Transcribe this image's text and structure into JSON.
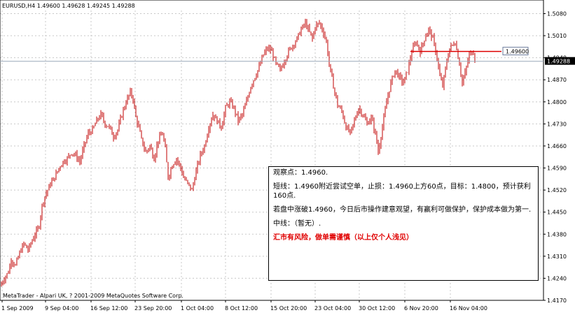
{
  "chart_header": "EURUSD,H4  1.49600 1.49628 1.49245 1.49288",
  "footer_text": "MetaTrader - Alpari UK, ? 2001-2009 MetaQuotes Software Corp.",
  "note": {
    "line1": "观察点：1.4960.",
    "line2": "短线：1.4960附近尝试空单，止损：1.4960上方60点，目标：1.4800，预计获利160点.",
    "line3": "若盘中涨破1.4960，今日后市操作建意观望，有赢利可做保护，保护成本做为第一.",
    "line4": "中线：（暂无）.",
    "warning": "汇市有风险，做单需谨慎（以上仅个人浅见）"
  },
  "colors": {
    "candle": "#c00000",
    "bid_line": "#9aa8b8",
    "hline": "#dd0000",
    "grid": "#c8c8c8"
  },
  "chart_data": {
    "type": "ohlc",
    "symbol": "EURUSD",
    "timeframe": "H4",
    "header": {
      "open": 1.496,
      "high": 1.49628,
      "low": 1.49245,
      "close": 1.49288
    },
    "ylim": [
      1.417,
      1.509
    ],
    "y_ticks": [
      1.508,
      1.501,
      1.494,
      1.487,
      1.48,
      1.473,
      1.466,
      1.459,
      1.452,
      1.445,
      1.438,
      1.431,
      1.424,
      1.417
    ],
    "x_ticks": [
      "1 Sep 2009",
      "9 Sep 04:00",
      "16 Sep 12:00",
      "23 Sep 20:00",
      "1 Oct 04:00",
      "8 Oct 12:00",
      "15 Oct 20:00",
      "23 Oct 04:00",
      "30 Oct 12:00",
      "6 Nov 20:00",
      "16 Nov 04:00"
    ],
    "current_price": "1.49288",
    "horizontal_line": {
      "price": 1.496,
      "label": "1.49600"
    },
    "path": [
      [
        0,
        1.4215
      ],
      [
        6,
        1.424
      ],
      [
        12,
        1.426
      ],
      [
        16,
        1.43
      ],
      [
        22,
        1.428
      ],
      [
        28,
        1.432
      ],
      [
        34,
        1.435
      ],
      [
        40,
        1.433
      ],
      [
        46,
        1.436
      ],
      [
        50,
        1.438
      ],
      [
        53,
        1.439
      ],
      [
        56,
        1.441
      ],
      [
        60,
        1.447
      ],
      [
        64,
        1.45
      ],
      [
        68,
        1.452
      ],
      [
        72,
        1.454
      ],
      [
        78,
        1.456
      ],
      [
        84,
        1.459
      ],
      [
        90,
        1.461
      ],
      [
        96,
        1.462
      ],
      [
        102,
        1.464
      ],
      [
        108,
        1.463
      ],
      [
        114,
        1.461
      ],
      [
        120,
        1.466
      ],
      [
        126,
        1.47
      ],
      [
        132,
        1.471
      ],
      [
        138,
        1.474
      ],
      [
        144,
        1.476
      ],
      [
        150,
        1.473
      ],
      [
        156,
        1.472
      ],
      [
        162,
        1.469
      ],
      [
        168,
        1.471
      ],
      [
        174,
        1.476
      ],
      [
        180,
        1.48
      ],
      [
        186,
        1.483
      ],
      [
        190,
        1.481
      ],
      [
        194,
        1.475
      ],
      [
        198,
        1.472
      ],
      [
        202,
        1.468
      ],
      [
        208,
        1.464
      ],
      [
        214,
        1.466
      ],
      [
        220,
        1.462
      ],
      [
        226,
        1.468
      ],
      [
        232,
        1.47
      ],
      [
        236,
        1.465
      ],
      [
        240,
        1.456
      ],
      [
        246,
        1.46
      ],
      [
        252,
        1.462
      ],
      [
        258,
        1.459
      ],
      [
        262,
        1.456
      ],
      [
        268,
        1.454
      ],
      [
        274,
        1.452
      ],
      [
        280,
        1.458
      ],
      [
        286,
        1.463
      ],
      [
        292,
        1.466
      ],
      [
        298,
        1.472
      ],
      [
        304,
        1.476
      ],
      [
        310,
        1.474
      ],
      [
        316,
        1.472
      ],
      [
        322,
        1.478
      ],
      [
        328,
        1.48
      ],
      [
        334,
        1.478
      ],
      [
        340,
        1.474
      ],
      [
        346,
        1.476
      ],
      [
        352,
        1.48
      ],
      [
        358,
        1.485
      ],
      [
        364,
        1.488
      ],
      [
        370,
        1.491
      ],
      [
        376,
        1.495
      ],
      [
        382,
        1.497
      ],
      [
        388,
        1.496
      ],
      [
        394,
        1.492
      ],
      [
        400,
        1.49
      ],
      [
        406,
        1.493
      ],
      [
        412,
        1.496
      ],
      [
        418,
        1.498
      ],
      [
        424,
        1.5
      ],
      [
        430,
        1.503
      ],
      [
        436,
        1.505
      ],
      [
        440,
        1.503
      ],
      [
        446,
        1.5
      ],
      [
        450,
        1.504
      ],
      [
        456,
        1.505
      ],
      [
        462,
        1.502
      ],
      [
        466,
        1.499
      ],
      [
        470,
        1.492
      ],
      [
        476,
        1.485
      ],
      [
        482,
        1.479
      ],
      [
        488,
        1.477
      ],
      [
        494,
        1.472
      ],
      [
        500,
        1.47
      ],
      [
        506,
        1.474
      ],
      [
        512,
        1.478
      ],
      [
        518,
        1.476
      ],
      [
        524,
        1.473
      ],
      [
        530,
        1.475
      ],
      [
        536,
        1.47
      ],
      [
        540,
        1.464
      ],
      [
        546,
        1.472
      ],
      [
        552,
        1.48
      ],
      [
        558,
        1.486
      ],
      [
        564,
        1.49
      ],
      [
        570,
        1.488
      ],
      [
        576,
        1.486
      ],
      [
        582,
        1.49
      ],
      [
        588,
        1.496
      ],
      [
        594,
        1.499
      ],
      [
        600,
        1.496
      ],
      [
        606,
        1.5
      ],
      [
        612,
        1.503
      ],
      [
        618,
        1.5
      ],
      [
        624,
        1.494
      ],
      [
        628,
        1.488
      ],
      [
        632,
        1.485
      ],
      [
        638,
        1.493
      ],
      [
        642,
        1.497
      ],
      [
        646,
        1.498
      ],
      [
        650,
        1.499
      ],
      [
        656,
        1.492
      ],
      [
        660,
        1.486
      ],
      [
        664,
        1.489
      ],
      [
        670,
        1.495
      ],
      [
        676,
        1.496
      ],
      [
        679,
        1.4929
      ]
    ]
  }
}
